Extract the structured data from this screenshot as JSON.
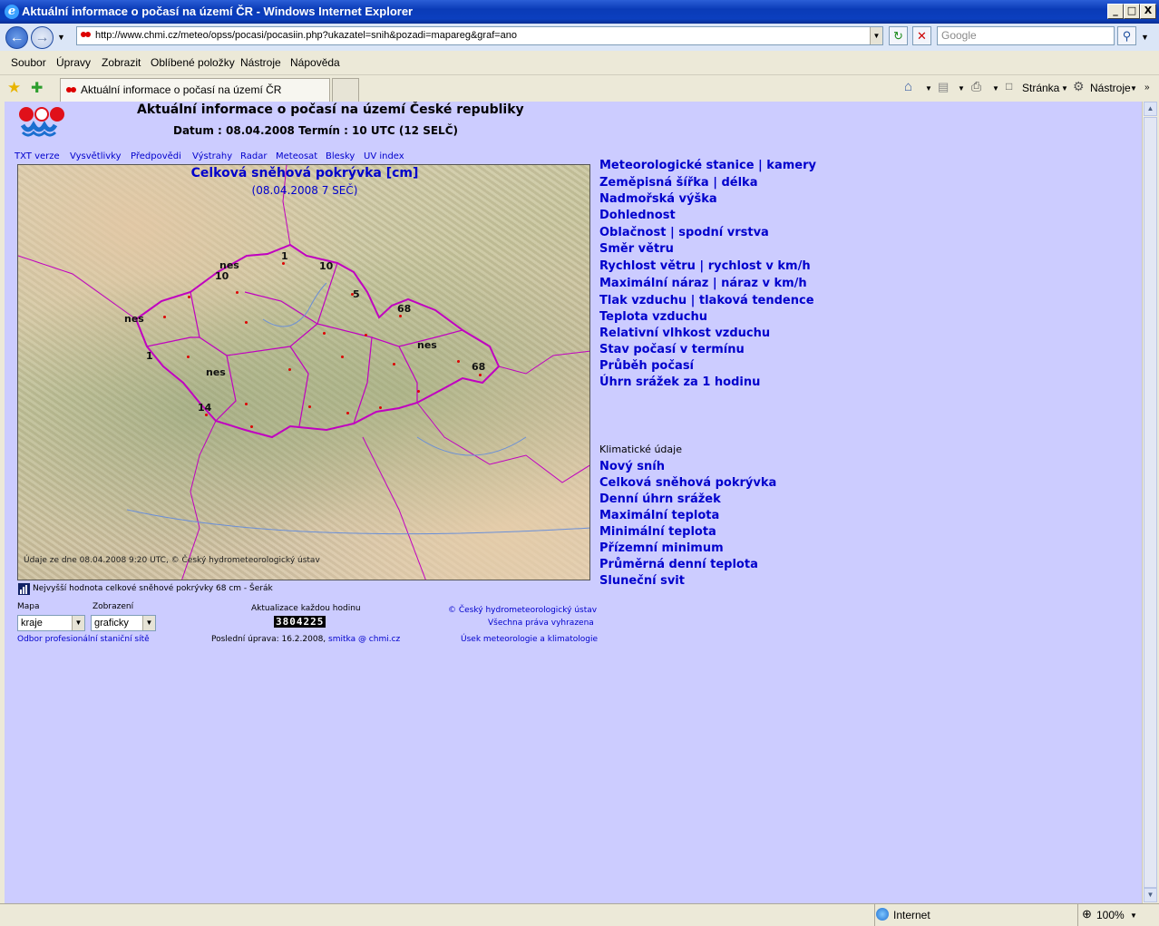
{
  "window": {
    "title": "Aktuální informace o počasí na území ČR - Windows Internet Explorer",
    "min_glyph": "_",
    "max_glyph": "□",
    "close_glyph": "X"
  },
  "addressbar": {
    "url": "http://www.chmi.cz/meteo/opss/pocasi/pocasiin.php?ukazatel=snih&pozadi=mapareg&graf=ano",
    "search_placeholder": "Google"
  },
  "menu": [
    "Soubor",
    "Úpravy",
    "Zobrazit",
    "Oblíbené položky",
    "Nástroje",
    "Nápověda"
  ],
  "tabs": {
    "active_label": "Aktuální informace o počasí na území ČR"
  },
  "toolbar": {
    "page_label": "Stránka",
    "tools_label": "Nástroje"
  },
  "page": {
    "heading": "Aktuální informace o počasí na území České republiky",
    "date_line": "Datum : 08.04.2008 Termín : 10 UTC (12 SELČ)",
    "top_links": [
      "TXT verze",
      "Vysvětlivky",
      "Předpovědi",
      "Výstrahy",
      "Radar",
      "Meteosat",
      "Blesky",
      "UV index"
    ],
    "map": {
      "title": "Celková sněhová pokrývka [cm]",
      "date": "(08.04.2008 7 SEČ)",
      "source": "Údaje ze dne 08.04.2008 9:20 UTC, © Český hydrometeorologický ústav",
      "labels": [
        "1",
        "10",
        "nes",
        "10",
        "5",
        "68",
        "nes",
        "nes",
        "1",
        "nes",
        "68",
        "14"
      ]
    },
    "max_note": "Nejvyšší hodnota celkové sněhové pokrývky 68 cm - Šerák",
    "controls": {
      "mapa_label": "Mapa",
      "mapa_value": "kraje",
      "zobrazeni_label": "Zobrazení",
      "zobrazeni_value": "graficky",
      "update_label": "Aktualizace každou hodinu",
      "counter": "3804225",
      "copyright": "© Český hydrometeorologický ústav",
      "rights": "Všechna práva vyhrazena",
      "dept_link": "Odbor profesionální staniční sítě",
      "last_update_prefix": "Poslední úprava: 16.2.2008,",
      "email": "smitka @ chmi.cz",
      "section_link": "Úsek meteorologie a klimatologie"
    },
    "right_links": [
      "Meteorologické stanice | kamery",
      "Zeměpisná šířka | délka",
      "Nadmořská výška",
      "Dohlednost",
      "Oblačnost | spodní vrstva",
      "Směr větru",
      "Rychlost větru | rychlost v km/h",
      "Maximální náraz | náraz v km/h",
      "Tlak vzduchu | tlaková tendence",
      "Teplota vzduchu",
      "Relativní vlhkost vzduchu",
      "Stav počasí v termínu",
      "Průběh počasí",
      "Úhrn srážek za 1 hodinu"
    ],
    "klima_heading": "Klimatické údaje",
    "klima_links": [
      "Nový sníh",
      "Celková sněhová pokrývka",
      "Denní úhrn srážek",
      "Maximální teplota",
      "Minimální teplota",
      "Přízemní minimum",
      "Průměrná denní teplota",
      "Sluneční svit"
    ]
  },
  "status": {
    "zone": "Internet",
    "zoom": "100%"
  }
}
